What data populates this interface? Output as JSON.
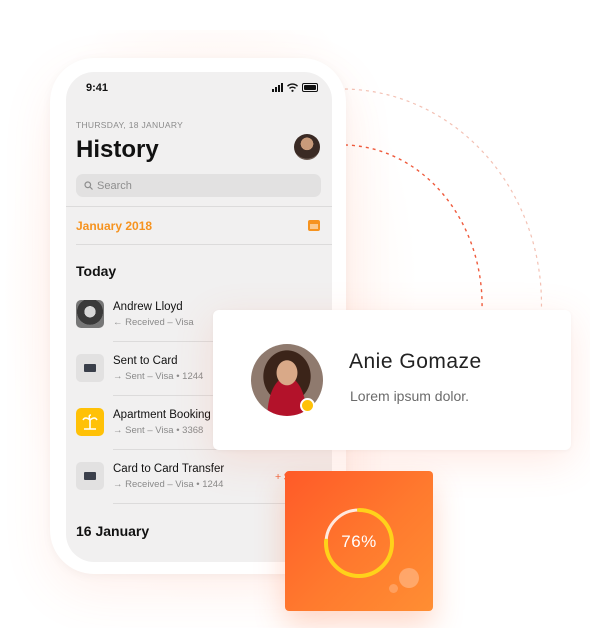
{
  "phone": {
    "status_time": "9:41",
    "date_label": "THURSDAY, 18 JANUARY",
    "title": "History",
    "search_placeholder": "Search",
    "month_label": "January 2018",
    "sections": [
      "Today",
      "16 January"
    ],
    "transactions": [
      {
        "name": "Andrew Lloyd",
        "detail": "← Received – Visa",
        "amount": "",
        "icon": "person-photo"
      },
      {
        "name": "Sent to Card",
        "detail": "→ Sent – Visa • 1244",
        "amount": "",
        "icon": "card-icon"
      },
      {
        "name": "Apartment Booking",
        "detail": "→ Sent – Visa • 3368",
        "amount": "",
        "icon": "palm-tree-icon"
      },
      {
        "name": "Card to Card Transfer",
        "detail": "→ Received – Visa • 1244",
        "amount": "+ $",
        "icon": "card-icon"
      }
    ]
  },
  "profile": {
    "name": "Anie Gomaze",
    "subtitle": "Lorem ipsum dolor."
  },
  "progress": {
    "label": "76%",
    "value": 0.76
  },
  "colors": {
    "accent_orange": "#f6931f",
    "card_gradient_start": "#ff5a28",
    "card_gradient_end": "#ff8e33",
    "ring_yellow": "#ffd21a",
    "status_dot": "#ffc107",
    "amount_red": "#f0623a"
  }
}
